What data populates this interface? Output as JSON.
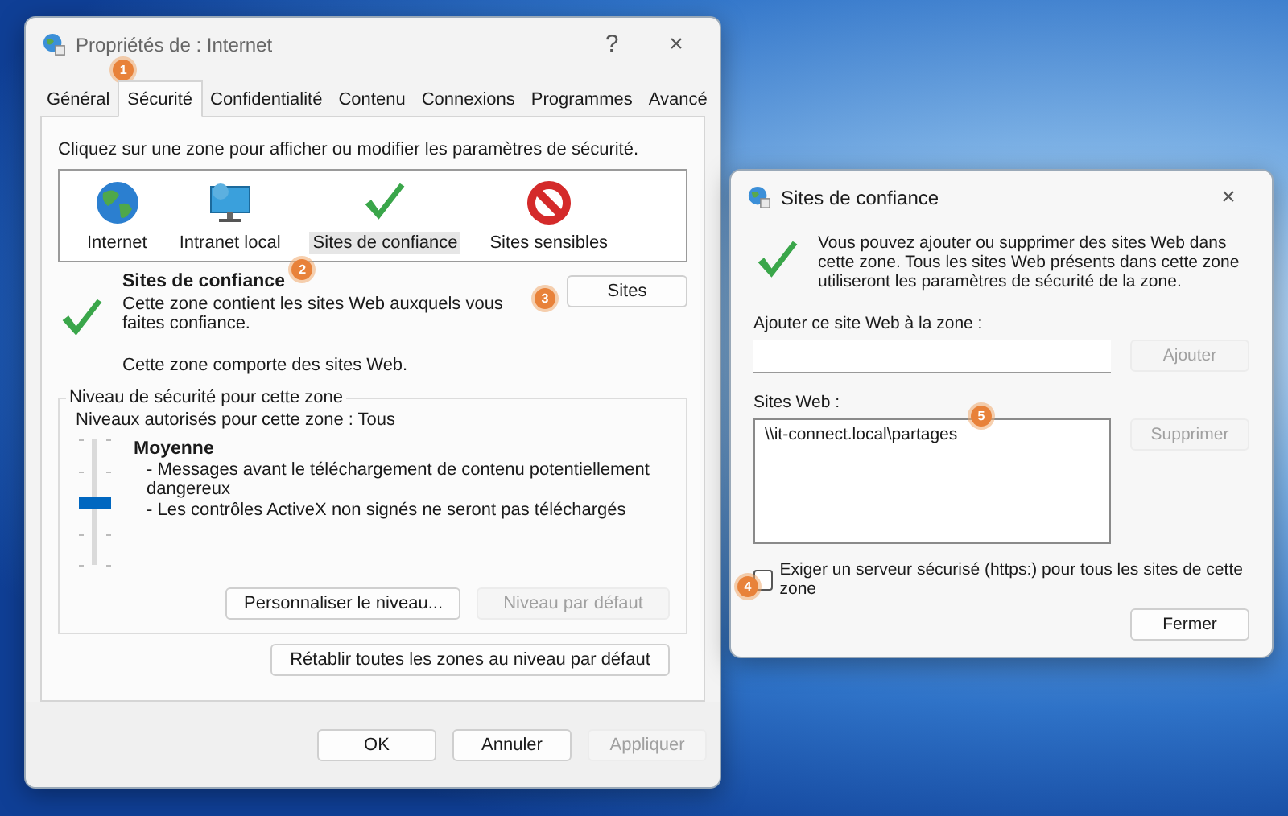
{
  "main_window": {
    "title": "Propriétés de : Internet",
    "help": "?",
    "close": "×",
    "tabs": [
      {
        "label": "Général",
        "selected": false
      },
      {
        "label": "Sécurité",
        "selected": true,
        "badge": "1"
      },
      {
        "label": "Confidentialité",
        "selected": false
      },
      {
        "label": "Contenu",
        "selected": false
      },
      {
        "label": "Connexions",
        "selected": false
      },
      {
        "label": "Programmes",
        "selected": false
      },
      {
        "label": "Avancé",
        "selected": false
      }
    ],
    "instruction": "Cliquez sur une zone pour afficher ou modifier les paramètres de sécurité.",
    "zones": [
      {
        "label": "Internet",
        "kind": "globe",
        "selected": false
      },
      {
        "label": "Intranet local",
        "kind": "monitor",
        "selected": false
      },
      {
        "label": "Sites de confiance",
        "kind": "check",
        "selected": true,
        "badge": "2"
      },
      {
        "label": "Sites sensibles",
        "kind": "blocked",
        "selected": false
      }
    ],
    "zone_info": {
      "title": "Sites de confiance",
      "description": "Cette zone contient les sites Web auxquels vous faites confiance.",
      "note": "Cette zone comporte des sites Web."
    },
    "sites_button": {
      "label": "Sites",
      "disabled": false,
      "badge": "3"
    },
    "security_level": {
      "legend": "Niveau de sécurité pour cette zone",
      "allowed": "Niveaux autorisés pour cette zone : Tous",
      "level": 0.5,
      "name": "Moyenne",
      "bullets": [
        "- Messages avant le téléchargement de contenu potentiellement dangereux",
        "- Les contrôles ActiveX non signés ne seront pas téléchargés"
      ],
      "buttons": [
        {
          "label": "Personnaliser le niveau...",
          "disabled": false
        },
        {
          "label": "Niveau par défaut",
          "disabled": true
        }
      ]
    },
    "reset_button": {
      "label": "Rétablir toutes les zones au niveau par défaut",
      "disabled": false
    },
    "footer_buttons": [
      {
        "label": "OK",
        "disabled": false
      },
      {
        "label": "Annuler",
        "disabled": false
      },
      {
        "label": "Appliquer",
        "disabled": true
      }
    ]
  },
  "sites_window": {
    "title": "Sites de confiance",
    "close": "×",
    "description": "Vous pouvez ajouter ou supprimer des sites Web dans cette zone. Tous les sites Web présents dans cette zone utiliseront les paramètres de sécurité de la zone.",
    "add_label": "Ajouter ce site Web à la zone :",
    "add_button": {
      "label": "Ajouter",
      "disabled": true
    },
    "list_label": "Sites Web :",
    "sites": [
      {
        "label": "\\\\it-connect.local\\partages",
        "selected": false
      }
    ],
    "list_badge": "5",
    "remove_button": {
      "label": "Supprimer",
      "disabled": true
    },
    "https_checkbox": {
      "label": "Exiger un serveur sécurisé (https:) pour tous les sites de cette zone",
      "checked": false,
      "badge": "4"
    },
    "close_button": {
      "label": "Fermer",
      "disabled": false
    }
  }
}
